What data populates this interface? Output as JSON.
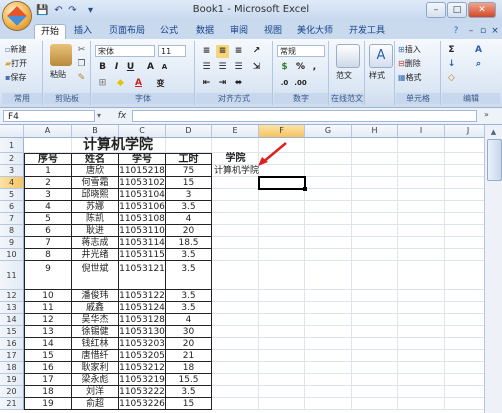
{
  "window": {
    "title": "Book1 - Microsoft Excel",
    "minimize": "–",
    "maximize": "□",
    "close": "✕"
  },
  "quick_access": {
    "save": "💾",
    "undo": "↶",
    "redo": "↷",
    "customize": "▾"
  },
  "tabs": [
    "开始",
    "插入",
    "页面布局",
    "公式",
    "数据",
    "审阅",
    "视图",
    "美化大师",
    "开发工具"
  ],
  "active_tab": 0,
  "ribbon": {
    "common": {
      "new": "新建",
      "open": "打开",
      "save": "保存",
      "label": "常用"
    },
    "clipboard": {
      "paste": "粘贴",
      "label": "剪贴板"
    },
    "font": {
      "name": "宋体",
      "size": "11",
      "bold": "B",
      "italic": "I",
      "underline": "U",
      "grow": "A",
      "shrink": "A",
      "color": "A",
      "phonetic": "变",
      "label": "字体"
    },
    "alignment": {
      "label": "对齐方式"
    },
    "number": {
      "format": "常规",
      "percent": "%",
      "comma": ",",
      "label": "数字"
    },
    "fanwen": {
      "button": "范文",
      "label": "在线范文"
    },
    "styles": {
      "button": "样式"
    },
    "cells": {
      "insert": "插入",
      "delete": "删除",
      "format": "格式",
      "label": "单元格"
    },
    "editing": {
      "sum": "Σ",
      "sort": "A",
      "fill": "↓",
      "clear": "◇",
      "label": "编辑"
    }
  },
  "formula_bar": {
    "name_box": "F4",
    "fx": "fx",
    "formula": ""
  },
  "columns": [
    "A",
    "B",
    "C",
    "D",
    "E",
    "F",
    "G",
    "H",
    "I",
    "J"
  ],
  "selected_column": "F",
  "selected_row": "4",
  "rows": [
    "1",
    "2",
    "3",
    "4",
    "5",
    "6",
    "7",
    "8",
    "9",
    "10",
    "11",
    "12",
    "13",
    "14",
    "15",
    "16",
    "17",
    "18",
    "19",
    "20",
    "21"
  ],
  "sheet": {
    "title": "计算机学院",
    "headers": [
      "序号",
      "姓名",
      "学号",
      "工时"
    ],
    "records": [
      [
        "1",
        "唐欣",
        "11015218",
        "75"
      ],
      [
        "2",
        "何雪霜",
        "11053102",
        "15"
      ],
      [
        "3",
        "邱晓熙",
        "11053104",
        "3"
      ],
      [
        "4",
        "苏娜",
        "11053106",
        "3.5"
      ],
      [
        "5",
        "陈凯",
        "11053108",
        "4"
      ],
      [
        "6",
        "耿进",
        "11053110",
        "20"
      ],
      [
        "7",
        "蒋志成",
        "11053114",
        "18.5"
      ],
      [
        "8",
        "井光绪",
        "11053115",
        "3.5"
      ],
      [
        "9",
        "倪世斌",
        "11053121",
        "3.5"
      ],
      [
        "10",
        "潘俊玮",
        "11053122",
        "3.5"
      ],
      [
        "11",
        "戚鑫",
        "11053124",
        "3.5"
      ],
      [
        "12",
        "吴华杰",
        "11053128",
        "4"
      ],
      [
        "13",
        "徐锡健",
        "11053130",
        "30"
      ],
      [
        "14",
        "钱红林",
        "11053203",
        "20"
      ],
      [
        "15",
        "唐惜纤",
        "11053205",
        "21"
      ],
      [
        "16",
        "耿家利",
        "11053212",
        "18"
      ],
      [
        "17",
        "梁永彪",
        "11053219",
        "15.5"
      ],
      [
        "18",
        "刘洋",
        "11053222",
        "3.5"
      ],
      [
        "19",
        "俞超",
        "11053226",
        "15"
      ]
    ],
    "e2": "学院",
    "e3": "计算机学院"
  },
  "colors": {
    "accent": "#15428b",
    "selection": "#000000",
    "annotation_arrow": "#e02020",
    "header_highlight": "#f5c462"
  }
}
